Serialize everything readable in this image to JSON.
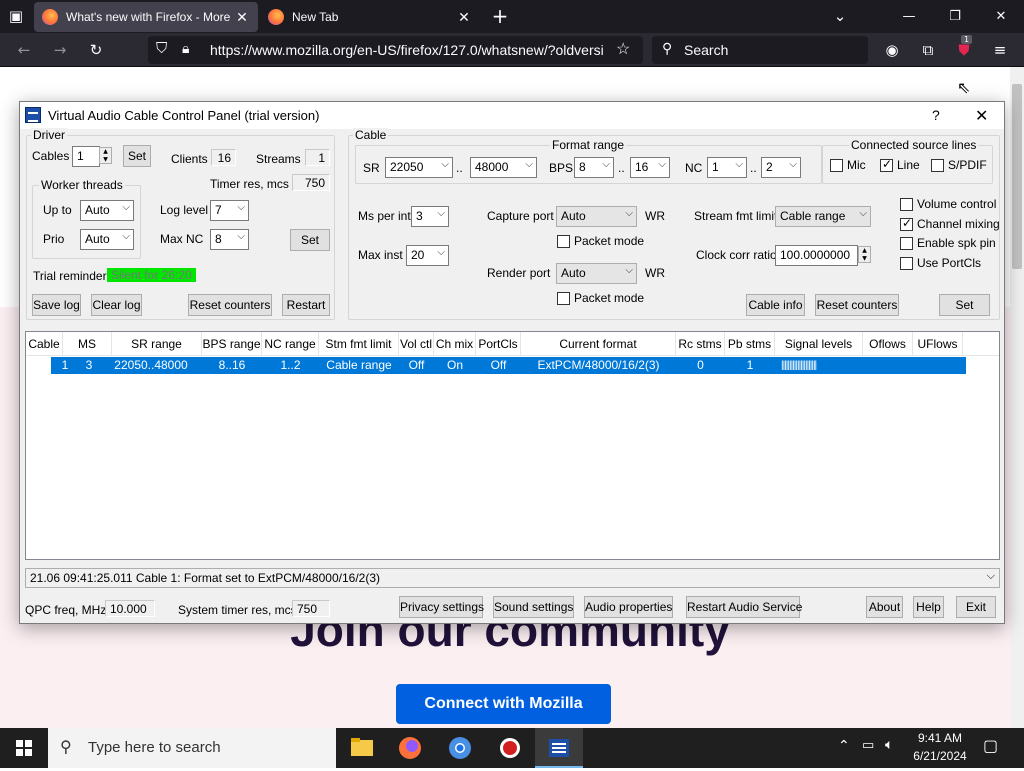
{
  "browser": {
    "tabs": [
      {
        "title": "What's new with Firefox - More",
        "close": "✕"
      },
      {
        "title": "New Tab",
        "close": "✕"
      }
    ],
    "new_tab": "+",
    "url": "https://www.mozilla.org/en-US/firefox/127.0/whatsnew/?oldversi",
    "search_placeholder": "Search",
    "badge": "1"
  },
  "page": {
    "heading": "Join our community",
    "cta": "Connect with Mozilla"
  },
  "vac": {
    "title": "Virtual Audio Cable Control Panel (trial version)",
    "help": "?",
    "close": "✕",
    "driver": {
      "group": "Driver",
      "cables_label": "Cables",
      "cables_value": "1",
      "set": "Set",
      "clients_label": "Clients",
      "clients_value": "16",
      "streams_label": "Streams",
      "streams_value": "1",
      "worker_threads": "Worker threads",
      "timer_label": "Timer res, mcs",
      "timer_value": "750",
      "upto_label": "Up to",
      "upto_value": "Auto",
      "prio_label": "Prio",
      "prio_value": "Auto",
      "loglevel_label": "Log level",
      "loglevel_value": "7",
      "maxnc_label": "Max NC",
      "maxnc_value": "8",
      "set2": "Set",
      "trial_label": "Trial reminder",
      "trial_value": "Silent for 26:20",
      "save_log": "Save log",
      "clear_log": "Clear log",
      "reset_counters": "Reset counters",
      "restart": "Restart"
    },
    "cable": {
      "group": "Cable",
      "format_range": "Format range",
      "sr_label": "SR",
      "sr_from": "22050",
      "sr_to": "48000",
      "dots": "..",
      "bps_label": "BPS",
      "bps_from": "8",
      "bps_to": "16",
      "nc_label": "NC",
      "nc_from": "1",
      "nc_to": "2",
      "connected_lines": "Connected source lines",
      "mic": "Mic",
      "line": "Line",
      "spdif": "S/PDIF",
      "ms_per_int_label": "Ms per int",
      "ms_per_int_value": "3",
      "max_inst_label": "Max inst",
      "max_inst_value": "20",
      "capture_port_label": "Capture port",
      "capture_port_value": "Auto",
      "wr": "WR",
      "packet_mode": "Packet mode",
      "render_port_label": "Render port",
      "render_port_value": "Auto",
      "stream_fmt_label": "Stream fmt limit",
      "stream_fmt_value": "Cable range",
      "clock_corr_label": "Clock corr ratio",
      "clock_corr_value": "100.0000000",
      "volume_control": "Volume control",
      "channel_mixing": "Channel mixing",
      "enable_spk_pin": "Enable spk pin",
      "use_portcls": "Use PortCls",
      "cable_info": "Cable info",
      "reset_counters": "Reset counters",
      "set": "Set"
    },
    "table": {
      "headers": [
        "Cable",
        "MS",
        "SR range",
        "BPS range",
        "NC range",
        "Stm fmt limit",
        "Vol ctl",
        "Ch mix",
        "PortCls",
        "Current format",
        "Rc stms",
        "Pb stms",
        "Signal levels",
        "Oflows",
        "UFlows"
      ],
      "row": [
        "1",
        "3",
        "22050..48000",
        "8..16",
        "1..2",
        "Cable range",
        "Off",
        "On",
        "Off",
        "ExtPCM/48000/16/2(3)",
        "0",
        "1",
        "||||||||||||||||||||||",
        "",
        ""
      ]
    },
    "log": "21.06  09:41:25.011  Cable 1: Format set to ExtPCM/48000/16/2(3)",
    "footer": {
      "qpc_label": "QPC freq, MHz",
      "qpc_value": "10.000",
      "systimer_label": "System timer res, mcs",
      "systimer_value": "750",
      "privacy": "Privacy settings",
      "sound": "Sound settings",
      "audio_props": "Audio properties",
      "restart_audio": "Restart Audio Service",
      "about": "About",
      "help": "Help",
      "exit": "Exit"
    }
  },
  "taskbar": {
    "search": "Type here to search",
    "time": "9:41 AM",
    "date": "6/21/2024"
  },
  "colors": {
    "accent": "#0078d7",
    "trial_bg": "#00e600",
    "mozilla_blue": "#0060df"
  }
}
